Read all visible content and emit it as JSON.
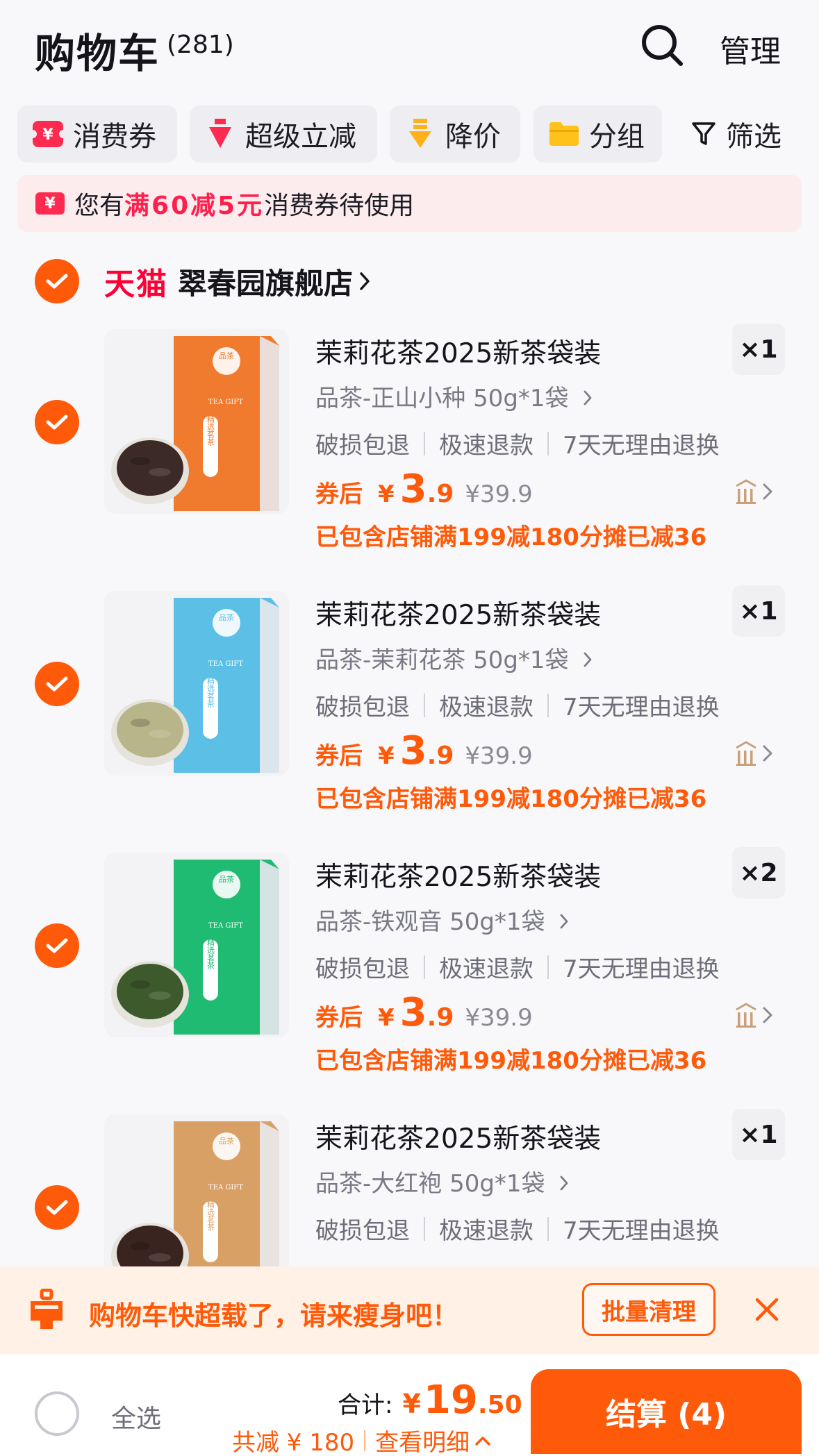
{
  "header": {
    "title": "购物车",
    "count": "(281)",
    "manage_label": "管理"
  },
  "filters": [
    {
      "label": "消费券",
      "icon": "coupon-icon"
    },
    {
      "label": "超级立减",
      "icon": "down-arrow-icon"
    },
    {
      "label": "降价",
      "icon": "price-drop-icon"
    },
    {
      "label": "分组",
      "icon": "folder-icon"
    }
  ],
  "filter_button": {
    "label": "筛选",
    "icon": "funnel-icon"
  },
  "coupon_banner": {
    "prefix": "您有",
    "highlight": "满60减5元",
    "suffix": "消费券待使用"
  },
  "store": {
    "platform": "天猫",
    "name": "翠春园旗舰店",
    "selected": true
  },
  "items": [
    {
      "title": "茉莉花茶2025新茶袋装",
      "sku": "品茶-正山小种 50g*1袋",
      "qty": "×1",
      "services": [
        "破损包退",
        "极速退款",
        "7天无理由退换"
      ],
      "price_label": "券后",
      "price_symbol": "¥",
      "price_int": "3",
      "price_dec": ".9",
      "orig_price": "¥39.9",
      "note": "已包含店铺满199减180分摊已减36",
      "bag_color": "#f07a2e",
      "leaf_color": "#3b2a26",
      "selected": true
    },
    {
      "title": "茉莉花茶2025新茶袋装",
      "sku": "品茶-茉莉花茶 50g*1袋",
      "qty": "×1",
      "services": [
        "破损包退",
        "极速退款",
        "7天无理由退换"
      ],
      "price_label": "券后",
      "price_symbol": "¥",
      "price_int": "3",
      "price_dec": ".9",
      "orig_price": "¥39.9",
      "note": "已包含店铺满199减180分摊已减36",
      "bag_color": "#5bbfe6",
      "leaf_color": "#b9b58a",
      "selected": true
    },
    {
      "title": "茉莉花茶2025新茶袋装",
      "sku": "品茶-铁观音 50g*1袋",
      "qty": "×2",
      "services": [
        "破损包退",
        "极速退款",
        "7天无理由退换"
      ],
      "price_label": "券后",
      "price_symbol": "¥",
      "price_int": "3",
      "price_dec": ".9",
      "orig_price": "¥39.9",
      "note": "已包含店铺满199减180分摊已减36",
      "bag_color": "#1fbb73",
      "leaf_color": "#3d5a2c",
      "selected": true
    },
    {
      "title": "茉莉花茶2025新茶袋装",
      "sku": "品茶-大红袍 50g*1袋",
      "qty": "×1",
      "services": [
        "破损包退",
        "极速退款",
        "7天无理由退换"
      ],
      "price_label": "",
      "price_symbol": "",
      "price_int": "",
      "price_dec": "",
      "orig_price": "",
      "note": "",
      "bag_color": "#d9a066",
      "leaf_color": "#3a2420",
      "selected": true
    }
  ],
  "bag_text": {
    "top": "品茶",
    "tea_gift": "TEA GIFT",
    "side": "精选茗茶"
  },
  "overload": {
    "message": "购物车快超载了，请来瘦身吧！",
    "button": "批量清理"
  },
  "bottom": {
    "select_all": "全选",
    "total_label": "合计:",
    "total_symbol": "¥",
    "total_int": "19",
    "total_dec": ".50",
    "saved": "共减 ¥ 180",
    "details": "查看明细",
    "checkout": "结算 (4)"
  },
  "colors": {
    "accent": "#ff5a0a",
    "tmall_red": "#ff0036",
    "coupon_red": "#ff1f4d"
  }
}
